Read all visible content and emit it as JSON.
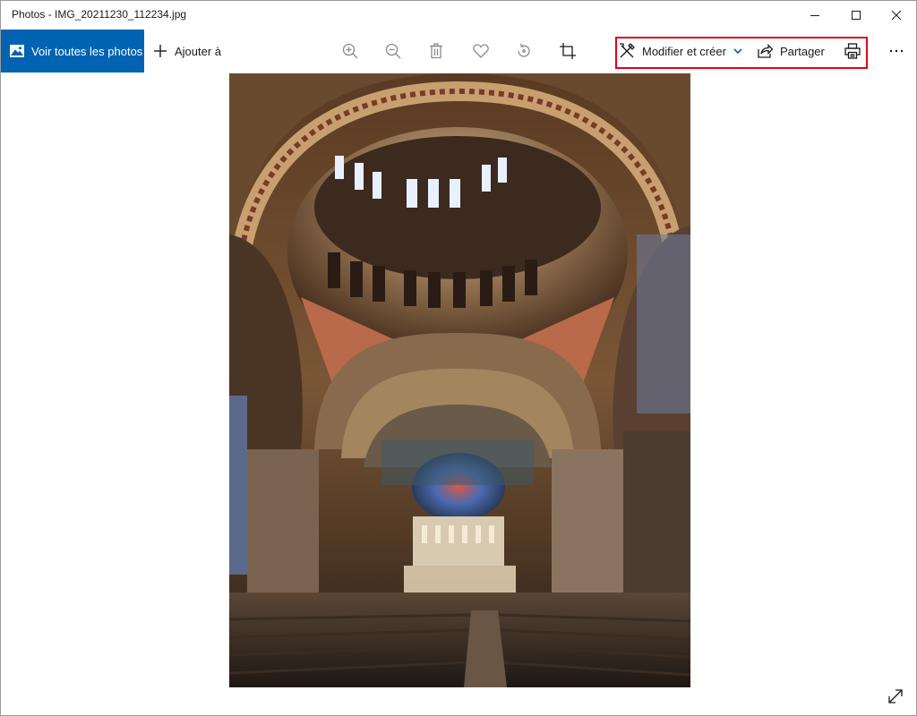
{
  "window": {
    "title": "Photos - IMG_20211230_112234.jpg"
  },
  "toolbar": {
    "see_all_label": "Voir toutes les photos",
    "add_label": "Ajouter à",
    "edit_label": "Modifier et créer",
    "share_label": "Partager",
    "more_label": "···"
  },
  "colors": {
    "accent": "#0063b1",
    "highlight_border": "#e3001b"
  },
  "icons": [
    "photos-app-icon",
    "plus-icon",
    "zoom-in-icon",
    "zoom-out-icon",
    "delete-icon",
    "favorite-heart-icon",
    "rotate-icon",
    "crop-icon",
    "edit-create-icon",
    "chevron-down-icon",
    "share-icon",
    "print-icon",
    "more-icon",
    "fullscreen-expand-icon"
  ]
}
